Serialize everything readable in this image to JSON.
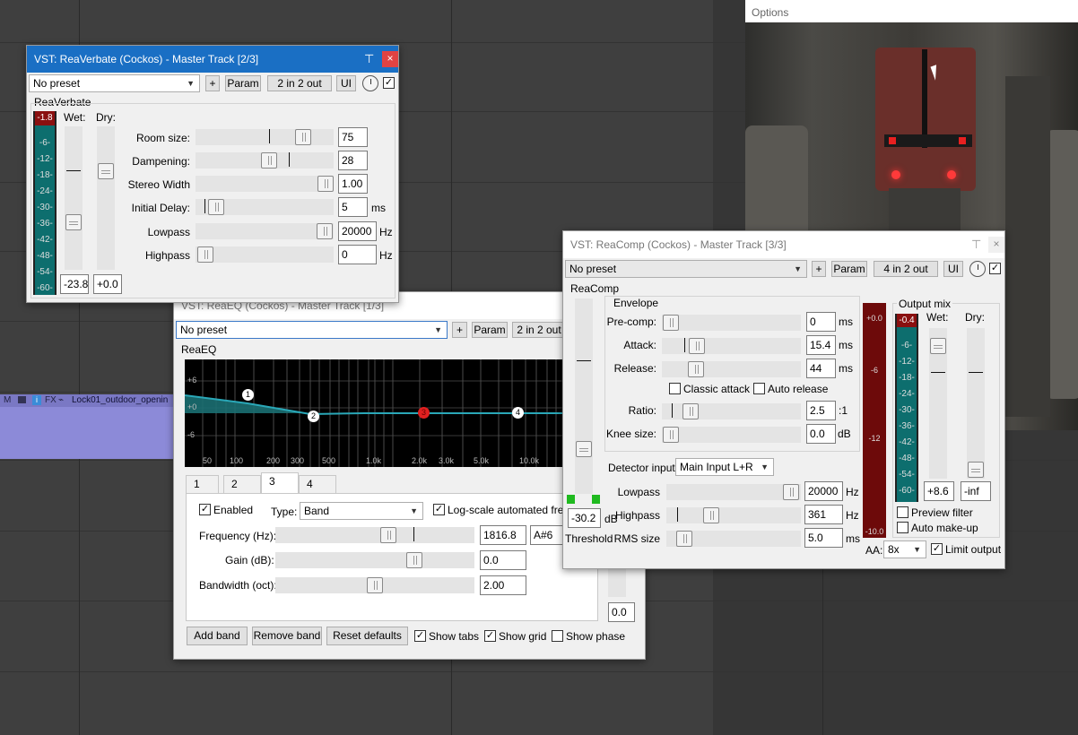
{
  "daw": {
    "track_controls": [
      "M",
      "FX"
    ],
    "track_item_label": "Lock01_outdoor_openin"
  },
  "options_window": {
    "title": "Options"
  },
  "reaverbate": {
    "title": "VST: ReaVerbate (Cockos) - Master Track [2/3]",
    "preset": "No preset",
    "plus_label": "+",
    "param_label": "Param",
    "io_label": "2 in 2 out",
    "ui_label": "UI",
    "plugin_name": "ReaVerbate",
    "wet_label": "Wet:",
    "dry_label": "Dry:",
    "meter_peak": "-1.8",
    "meter_scale": [
      "-6-",
      "-12-",
      "-18-",
      "-24-",
      "-30-",
      "-36-",
      "-42-",
      "-48-",
      "-54-",
      "-60-"
    ],
    "wet_value": "-23.8",
    "dry_value": "+0.0",
    "params": [
      {
        "label": "Room size:",
        "value": "75",
        "unit": ""
      },
      {
        "label": "Dampening:",
        "value": "28",
        "unit": ""
      },
      {
        "label": "Stereo Width",
        "value": "1.00",
        "unit": ""
      },
      {
        "label": "Initial Delay:",
        "value": "5",
        "unit": "ms"
      },
      {
        "label": "Lowpass",
        "value": "20000",
        "unit": "Hz"
      },
      {
        "label": "Highpass",
        "value": "0",
        "unit": "Hz"
      }
    ]
  },
  "reaeq": {
    "title": "VST: ReaEQ (Cockos) - Master Track [1/3]",
    "preset": "No preset",
    "plus_label": "+",
    "param_label": "Param",
    "io_label": "2 in 2 out",
    "plugin_name": "ReaEQ",
    "graph_db_labels": [
      "+6",
      "+0",
      "-6"
    ],
    "graph_freq_labels": [
      "50",
      "100",
      "200",
      "300",
      "500",
      "1.0k",
      "2.0k",
      "3.0k",
      "5.0k",
      "10.0k"
    ],
    "band_nodes": [
      "1",
      "2",
      "3",
      "4"
    ],
    "tabs": [
      "1",
      "2",
      "3",
      "4"
    ],
    "active_tab": "3",
    "enabled_label": "Enabled",
    "type_label": "Type:",
    "type_value": "Band",
    "log_scale_label": "Log-scale automated freque",
    "frequency_label": "Frequency (Hz):",
    "frequency_value": "1816.8",
    "note_value": "A#6",
    "gain_label": "Gain (dB):",
    "gain_value": "0.0",
    "bandwidth_label": "Bandwidth (oct):",
    "bandwidth_value": "2.00",
    "output_value": "0.0",
    "add_band": "Add band",
    "remove_band": "Remove band",
    "reset_defaults": "Reset defaults",
    "show_tabs": "Show tabs",
    "show_grid": "Show grid",
    "show_phase": "Show phase"
  },
  "reacomp": {
    "title": "VST: ReaComp (Cockos) - Master Track [3/3]",
    "preset": "No preset",
    "plus_label": "+",
    "param_label": "Param",
    "io_label": "4 in 2 out",
    "ui_label": "UI",
    "plugin_name": "ReaComp",
    "envelope_label": "Envelope",
    "precomp_label": "Pre-comp:",
    "precomp_value": "0",
    "attack_label": "Attack:",
    "attack_value": "15.4",
    "release_label": "Release:",
    "release_value": "44",
    "unit_ms": "ms",
    "classic_attack": "Classic attack",
    "auto_release": "Auto release",
    "ratio_label": "Ratio:",
    "ratio_value": "2.5",
    "ratio_unit": ":1",
    "knee_label": "Knee size:",
    "knee_value": "0.0",
    "knee_unit": "dB",
    "detector_label": "Detector input:",
    "detector_value": "Main Input L+R",
    "lowpass_label": "Lowpass",
    "lowpass_value": "20000",
    "highpass_label": "Highpass",
    "highpass_value": "361",
    "unit_hz": "Hz",
    "rms_label": "RMS size",
    "rms_value": "5.0",
    "threshold_value": "-30.2",
    "threshold_unit": "dB",
    "threshold_label": "Threshold",
    "gr_scale": [
      "+0.0",
      "-6",
      "-12",
      "-10.0"
    ],
    "output_mix_label": "Output mix",
    "out_peak": "-0.4",
    "wet_label": "Wet:",
    "dry_label": "Dry:",
    "out_scale": [
      "-6-",
      "-12-",
      "-18-",
      "-24-",
      "-30-",
      "-36-",
      "-42-",
      "-48-",
      "-54-",
      "-60-"
    ],
    "wet_value": "+8.6",
    "dry_value": "-inf",
    "preview_filter": "Preview filter",
    "auto_makeup": "Auto make-up",
    "aa_label": "AA:",
    "aa_value": "8x",
    "limit_output": "Limit output"
  },
  "colors": {
    "titlebar_active": "#1a6fc4",
    "meter_teal": "#0d6e6e",
    "gr_meter": "#7a0a0a",
    "eq_curve": "#2aa8b8",
    "close_red": "#e04343"
  }
}
